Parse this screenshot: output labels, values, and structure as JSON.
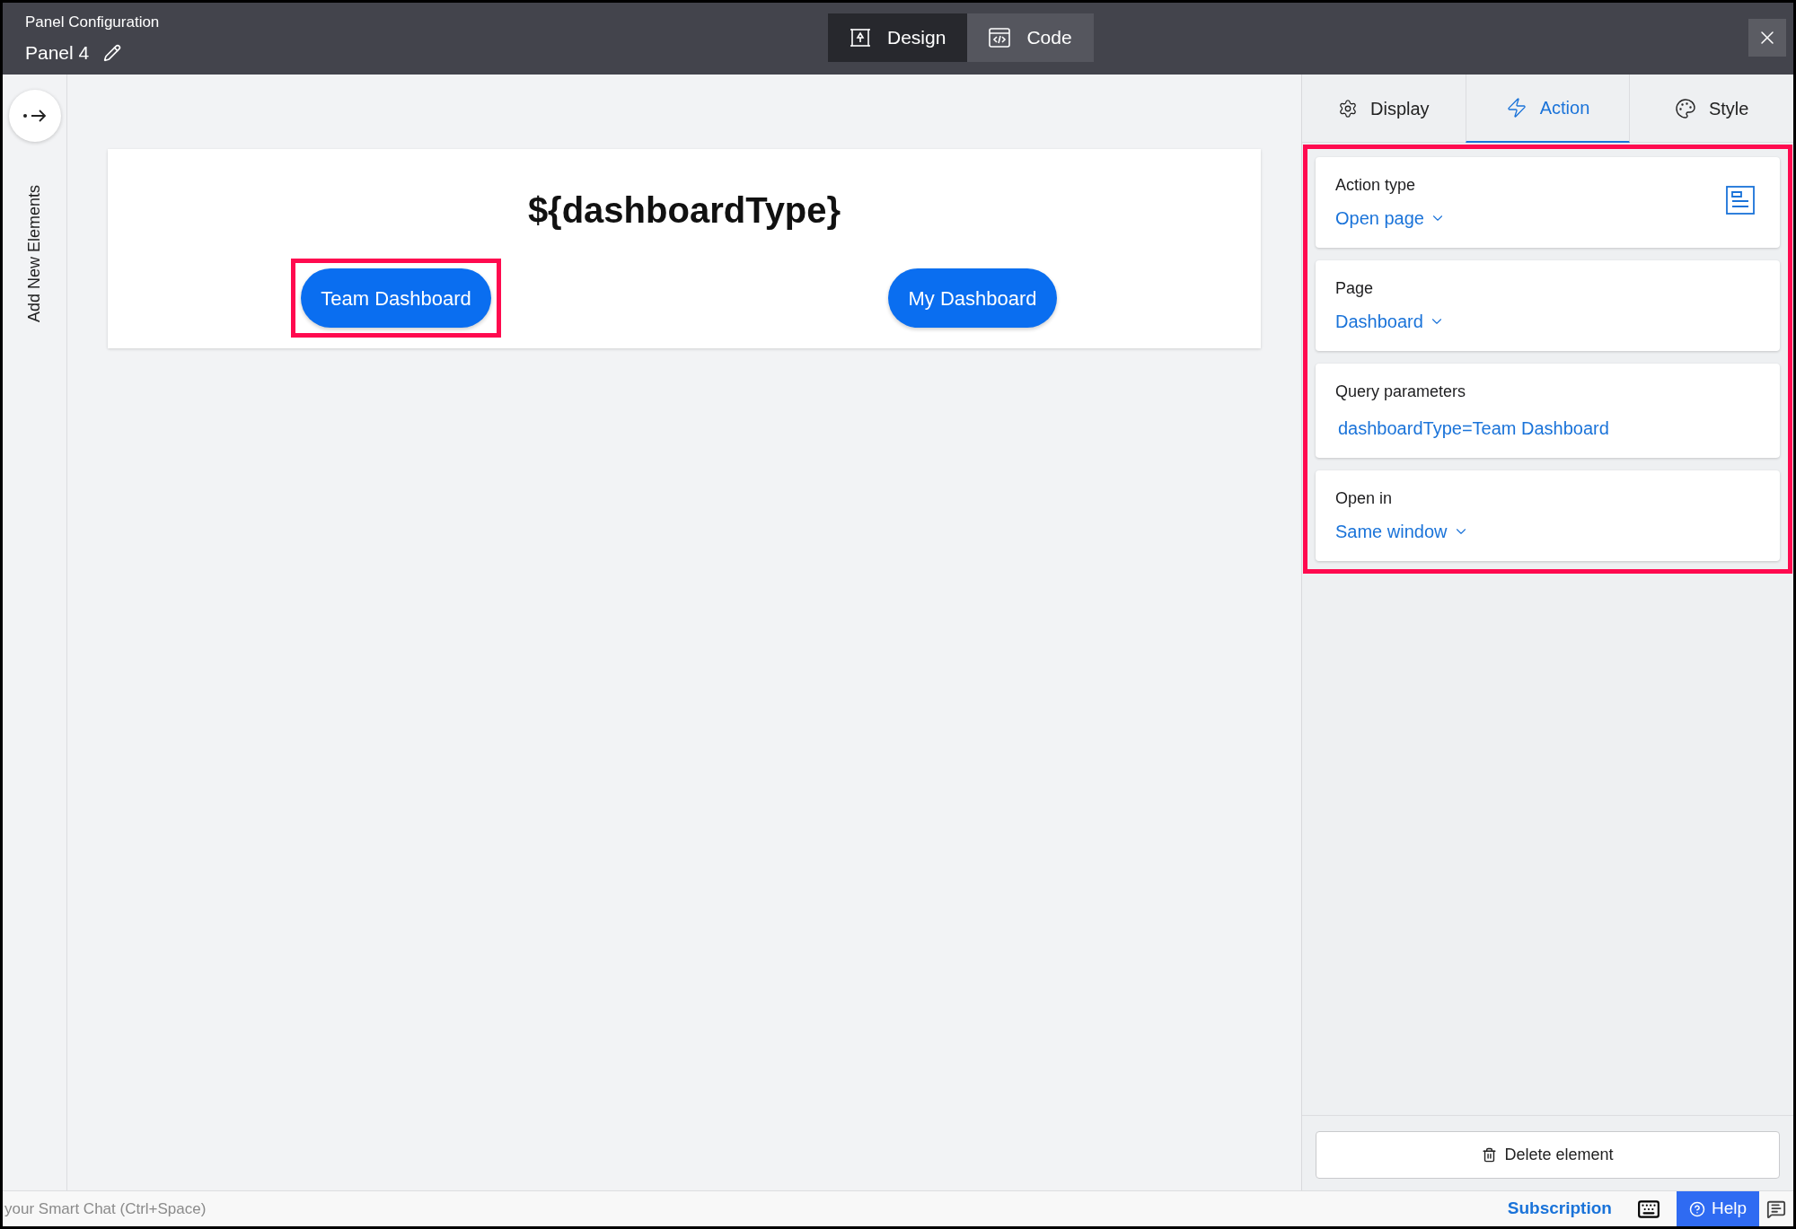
{
  "header": {
    "subtitle": "Panel Configuration",
    "title": "Panel 4"
  },
  "mode_tabs": [
    {
      "label": "Design",
      "kind": "design",
      "selected": true
    },
    {
      "label": "Code",
      "kind": "code",
      "selected": false
    }
  ],
  "sidebar": {
    "label": "Add New Elements"
  },
  "canvas": {
    "heading": "${dashboardType}",
    "buttons": [
      {
        "label": "Team Dashboard",
        "highlighted": true
      },
      {
        "label": "My Dashboard",
        "highlighted": false
      }
    ]
  },
  "settings_tabs": [
    {
      "label": "Display",
      "kind": "display",
      "selected": false
    },
    {
      "label": "Action",
      "kind": "action",
      "selected": true
    },
    {
      "label": "Style",
      "kind": "style",
      "selected": false
    }
  ],
  "settings": {
    "highlighted": true,
    "fields": [
      {
        "label": "Action type",
        "value": "Open page",
        "kind": "dropdown",
        "page_icon": true
      },
      {
        "label": "Page",
        "value": "Dashboard",
        "kind": "dropdown",
        "page_icon": false
      },
      {
        "label": "Query parameters",
        "value": "dashboardType=Team Dashboard",
        "kind": "text",
        "page_icon": false
      },
      {
        "label": "Open in",
        "value": "Same window",
        "kind": "dropdown",
        "page_icon": false
      }
    ]
  },
  "delete_button": "Delete element",
  "status_bar": {
    "chat_hint": "your Smart Chat (Ctrl+Space)",
    "subscription": "Subscription",
    "help": "Help"
  }
}
